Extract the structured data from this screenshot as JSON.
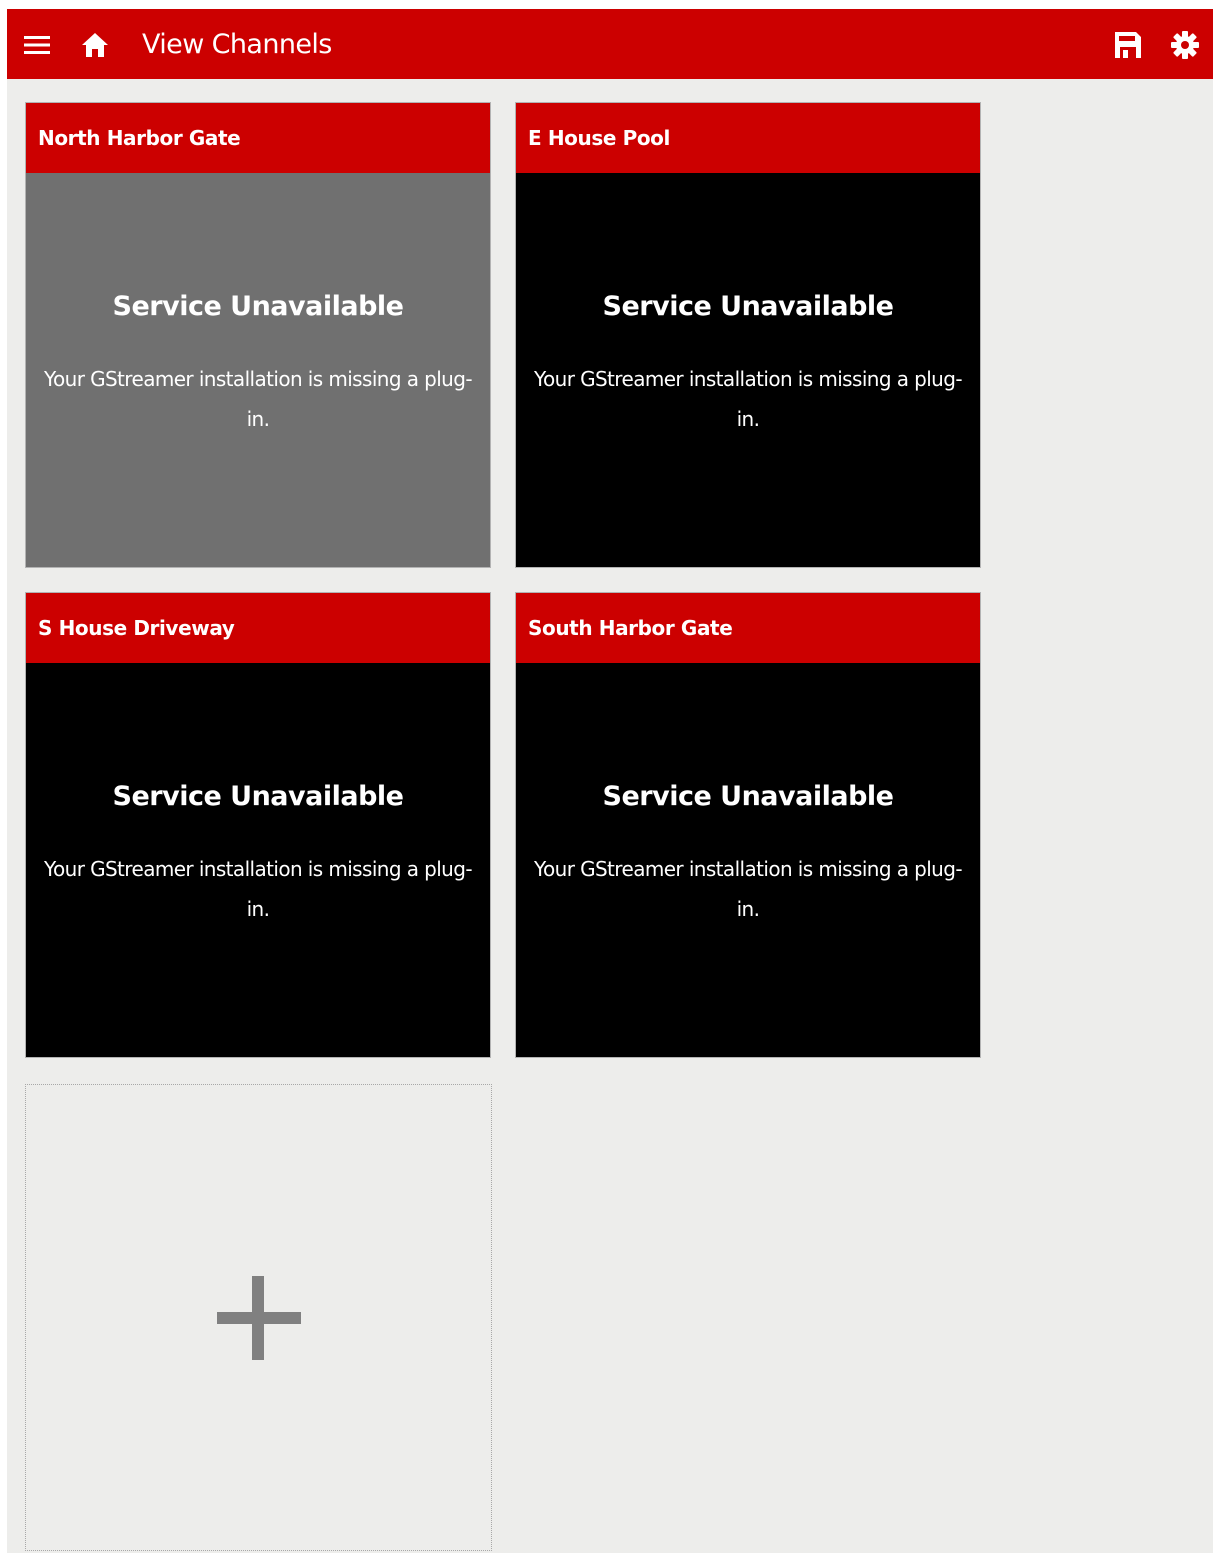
{
  "header": {
    "title": "View Channels",
    "menu_icon": "hamburger-menu-icon",
    "home_icon": "home-icon",
    "save_icon": "save-icon",
    "settings_icon": "gear-icon"
  },
  "colors": {
    "brand_red": "#cc0000",
    "page_background": "#ededeb",
    "tile_video_background": "#000000",
    "tile_selected_background": "#707070",
    "text": "#ffffff"
  },
  "channels": [
    {
      "name": "North Harbor Gate",
      "status_title": "Service Unavailable",
      "status_message": "Your GStreamer installation is missing a plug-in.",
      "selected": true
    },
    {
      "name": "E House Pool",
      "status_title": "Service Unavailable",
      "status_message": "Your GStreamer installation is missing a plug-in.",
      "selected": false
    },
    {
      "name": "S House Driveway",
      "status_title": "Service Unavailable",
      "status_message": "Your GStreamer installation is missing a plug-in.",
      "selected": false
    },
    {
      "name": "South Harbor Gate",
      "status_title": "Service Unavailable",
      "status_message": "Your GStreamer installation is missing a plug-in.",
      "selected": false
    }
  ],
  "add_tile": {
    "icon": "plus-icon"
  }
}
